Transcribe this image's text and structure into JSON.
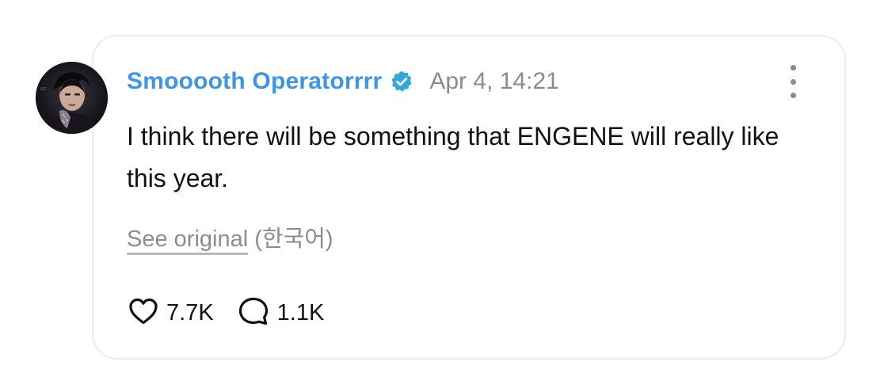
{
  "post": {
    "author": {
      "display_name": "Smooooth Operatorrrr",
      "verified": true,
      "avatar_icon": "profile-photo"
    },
    "timestamp": "Apr 4, 14:21",
    "text": "I think there will be something that ENGENE will really like this year.",
    "translation": {
      "see_original_label": "See original",
      "language_note": "(한국어)"
    },
    "stats": {
      "likes": "7.7K",
      "replies": "1.1K"
    },
    "icons": {
      "like": "heart-icon",
      "reply": "speech-bubble-icon",
      "more": "more-vertical-icon",
      "verified": "verified-badge-icon"
    },
    "colors": {
      "username": "#3c95e6",
      "verified_badge": "#31a9d8",
      "muted_text": "#8a8a8a"
    }
  }
}
